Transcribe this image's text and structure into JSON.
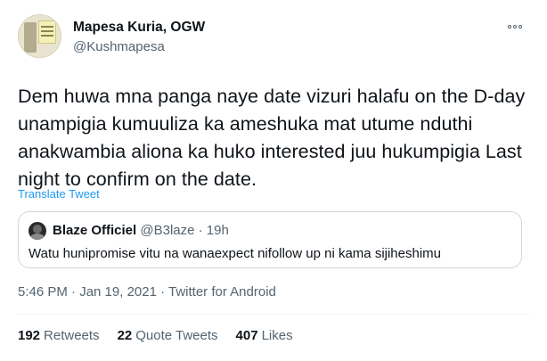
{
  "author": {
    "name": "Mapesa Kuria, OGW",
    "handle": "@Kushmapesa"
  },
  "tweet": {
    "text": "Dem huwa mna panga naye date vizuri halafu on the D-day unampigia kumuuliza ka ameshuka mat utume nduthi anakwambia aliona ka huko interested juu hukumpigia Last night to confirm on the date.",
    "translate_label": "Translate Tweet",
    "timestamp": "5:46 PM · Jan 19, 2021 · Twitter for Android"
  },
  "quoted_tweet": {
    "name": "Blaze Officiel",
    "meta": "@B3laze · 19h",
    "text": "Watu hunipromise vitu na wanaexpect nifollow up ni kama sijiheshimu"
  },
  "stats": [
    {
      "count": "192",
      "label": "Retweets"
    },
    {
      "count": "22",
      "label": "Quote Tweets"
    },
    {
      "count": "407",
      "label": "Likes"
    }
  ],
  "icons": {
    "more": "more-dots-icon"
  },
  "colors": {
    "accent": "#1d9bf0",
    "secondary_text": "#536471",
    "primary_text": "#0f1419",
    "border": "#cfd9de"
  }
}
